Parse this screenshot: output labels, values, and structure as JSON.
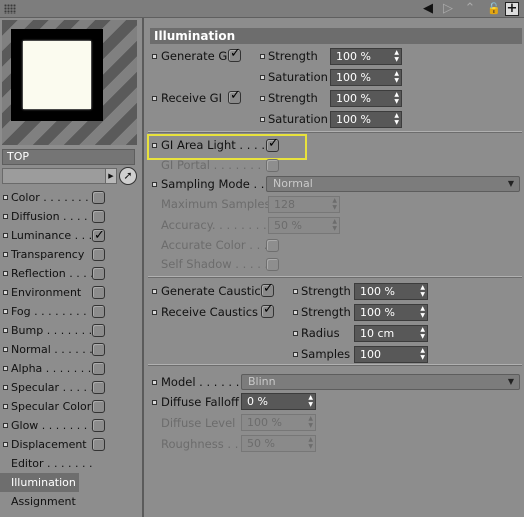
{
  "toolbar": {
    "back_icon": "◀",
    "forward_icon": "▷",
    "up_icon": "⌃",
    "lock_icon": "🔓",
    "new_icon": "+"
  },
  "sidebar": {
    "material_name": "TOP",
    "channels": [
      {
        "label": "Color . . . . . . .",
        "checked": false
      },
      {
        "label": "Diffusion  . . . .",
        "checked": false
      },
      {
        "label": "Luminance . . . .",
        "checked": true
      },
      {
        "label": "Transparency",
        "checked": false
      },
      {
        "label": "Reflection . . . .",
        "checked": false
      },
      {
        "label": "Environment",
        "checked": false
      },
      {
        "label": "Fog . . . . . . . .",
        "checked": false
      },
      {
        "label": "Bump  . . . . . . .",
        "checked": false
      },
      {
        "label": "Normal . . . . . .",
        "checked": false
      },
      {
        "label": "Alpha . . . . . . .",
        "checked": false
      },
      {
        "label": "Specular . . . . .",
        "checked": false
      },
      {
        "label": "Specular Color",
        "checked": false
      },
      {
        "label": "Glow . . . . . . . .",
        "checked": false
      },
      {
        "label": "Displacement",
        "checked": false
      }
    ],
    "extra": [
      "Editor  . . . . . . .",
      "Illumination",
      "Assignment"
    ]
  },
  "panel": {
    "title": "Illumination",
    "generate_gi": "Generate GI",
    "receive_gi": "Receive GI",
    "strength": "Strength",
    "saturation": "Saturation",
    "gi_values": [
      "100 %",
      "100 %",
      "100 %",
      "100 %"
    ],
    "gi_area_light": "GI Area Light . . . .",
    "gi_portal": "GI Portal . . . . . . . .",
    "sampling_mode": "Sampling Mode . . . .",
    "sampling_value": "Normal",
    "max_samples": "Maximum Samples",
    "max_samples_value": "128",
    "accuracy": "Accuracy. . . . . . . . .",
    "accuracy_value": "50 %",
    "accurate_color": "Accurate Color  . . .",
    "self_shadow": "Self Shadow  . . . . .",
    "generate_caustics": "Generate Caustics",
    "receive_caustics": "Receive Caustics",
    "radius": "Radius",
    "samples": "Samples",
    "caustic_values": [
      "100 %",
      "100 %",
      "10 cm",
      "100"
    ],
    "model": "Model . . . . . . . .",
    "model_value": "Blinn",
    "diffuse_falloff": "Diffuse Falloff",
    "diffuse_falloff_value": "0 %",
    "diffuse_level": "Diffuse Level",
    "diffuse_level_value": "100 %",
    "roughness": "Roughness . . .",
    "roughness_value": "50 %"
  }
}
